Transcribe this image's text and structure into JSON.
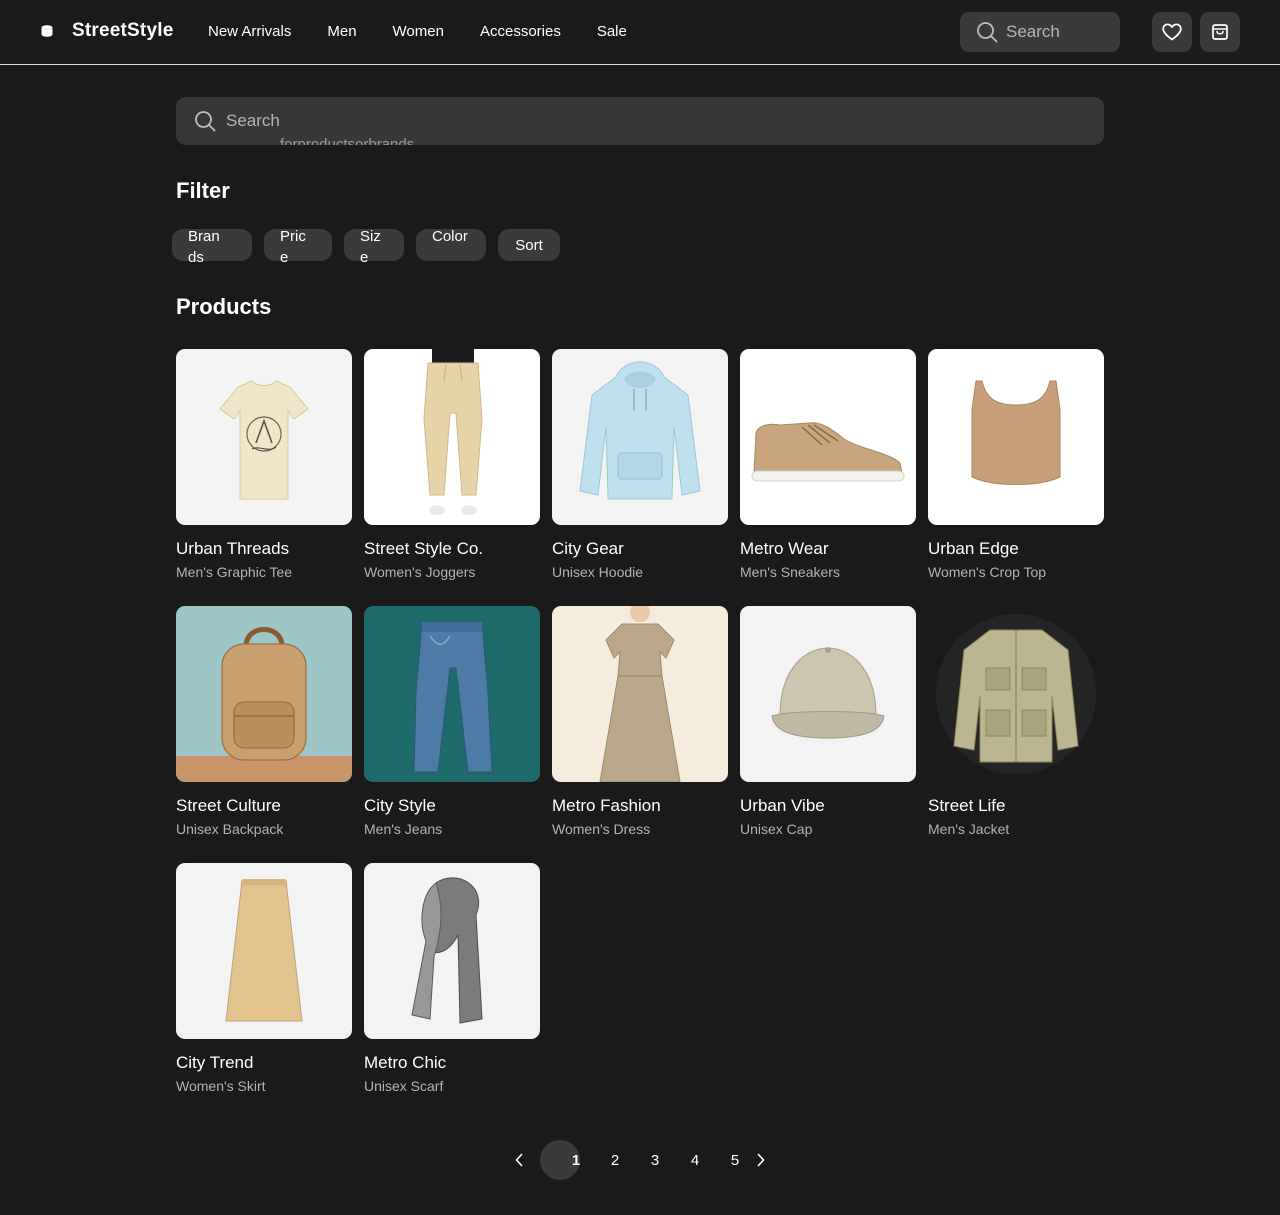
{
  "header": {
    "brand": "StreetStyle",
    "nav": [
      "New Arrivals",
      "Men",
      "Women",
      "Accessories",
      "Sale"
    ],
    "search_placeholder": "Search",
    "icons": {
      "logo": "cylinder-logo-icon",
      "wishlist": "heart-icon",
      "cart": "bag-icon",
      "search": "search-icon"
    }
  },
  "search": {
    "placeholder": "Search",
    "overflow_text": "forproductsorbrands"
  },
  "filter": {
    "title": "Filter",
    "chips": [
      "Brands",
      "Price",
      "Size",
      "Color",
      "Sort"
    ]
  },
  "products": {
    "title": "Products",
    "items": [
      {
        "name": "Urban Threads",
        "subtitle": "Men's Graphic Tee",
        "image": "cream-graphic-tshirt"
      },
      {
        "name": "Street Style Co.",
        "subtitle": "Women's Joggers",
        "image": "beige-joggers"
      },
      {
        "name": "City Gear",
        "subtitle": "Unisex Hoodie",
        "image": "light-blue-hoodie"
      },
      {
        "name": "Metro Wear",
        "subtitle": "Men's Sneakers",
        "image": "tan-sneaker"
      },
      {
        "name": "Urban Edge",
        "subtitle": "Women's Crop Top",
        "image": "tan-crop-top"
      },
      {
        "name": "Street Culture",
        "subtitle": "Unisex Backpack",
        "image": "tan-backpack"
      },
      {
        "name": "City Style",
        "subtitle": "Men's Jeans",
        "image": "blue-jeans"
      },
      {
        "name": "Metro Fashion",
        "subtitle": "Women's Dress",
        "image": "olive-dress"
      },
      {
        "name": "Urban Vibe",
        "subtitle": "Unisex Cap",
        "image": "khaki-cap"
      },
      {
        "name": "Street Life",
        "subtitle": "Men's Jacket",
        "image": "khaki-jacket"
      },
      {
        "name": "City Trend",
        "subtitle": "Women's Skirt",
        "image": "tan-skirt"
      },
      {
        "name": "Metro Chic",
        "subtitle": "Unisex Scarf",
        "image": "gray-scarf"
      }
    ]
  },
  "pagination": {
    "pages": [
      "1",
      "2",
      "3",
      "4",
      "5"
    ],
    "current": "1",
    "prev_icon": "chevron-left-icon",
    "next_icon": "chevron-right-icon"
  },
  "colors": {
    "background": "#1a1a1a",
    "surface": "#3a3a3a",
    "text": "#ffffff",
    "muted": "#b3b3b3"
  }
}
